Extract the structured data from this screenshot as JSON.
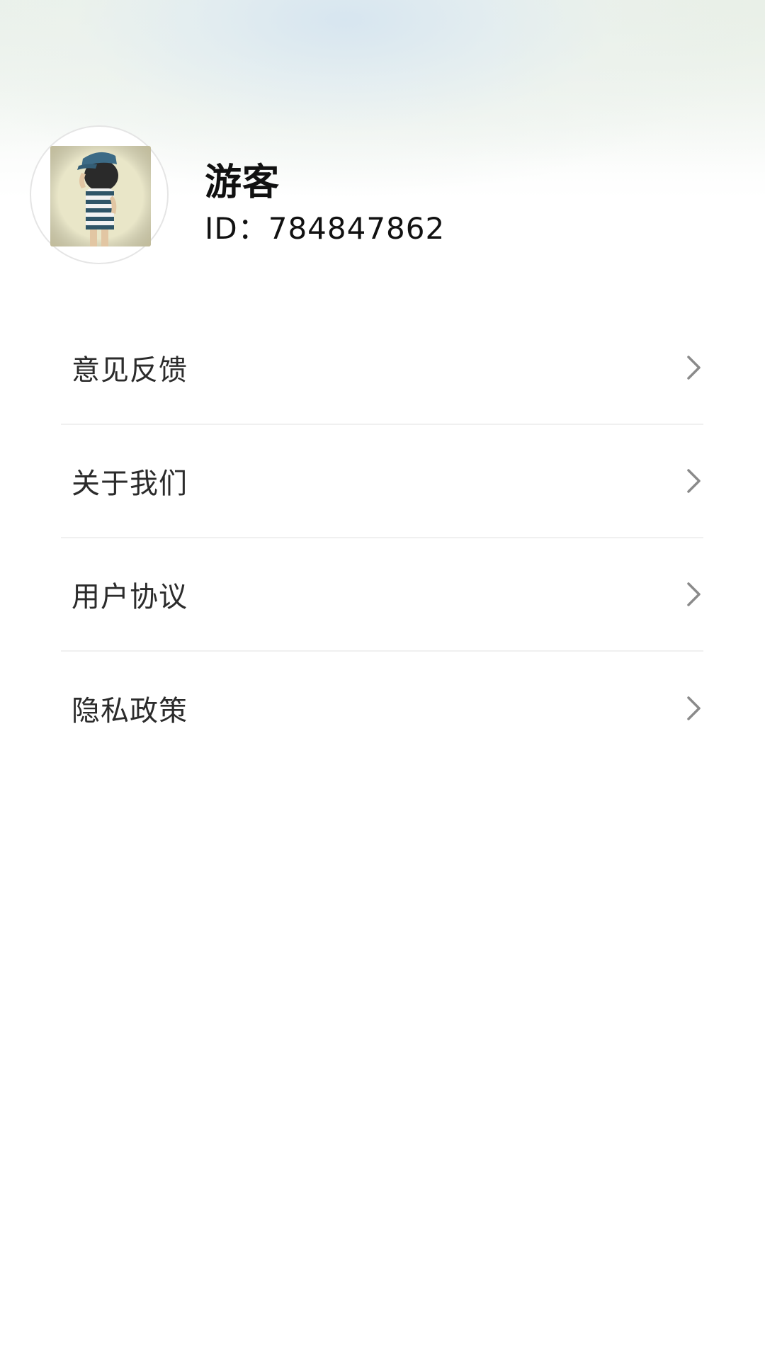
{
  "profile": {
    "name": "游客",
    "id_text": "ID：784847862",
    "avatar_icon": "user-avatar-photo"
  },
  "menu": {
    "items": [
      {
        "label": "意见反馈",
        "icon": "chevron-right-icon"
      },
      {
        "label": "关于我们",
        "icon": "chevron-right-icon"
      },
      {
        "label": "用户协议",
        "icon": "chevron-right-icon"
      },
      {
        "label": "隐私政策",
        "icon": "chevron-right-icon"
      }
    ]
  },
  "colors": {
    "text_primary": "#111111",
    "menu_text": "#2b2b2b",
    "chevron": "#8a8a8a",
    "divider": "#f0f0f0"
  }
}
